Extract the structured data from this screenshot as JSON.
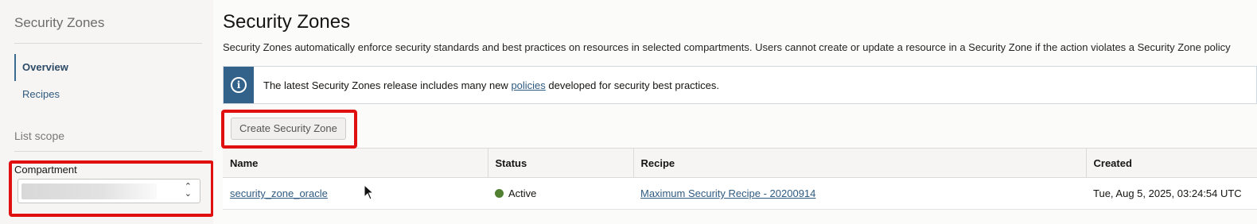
{
  "sidebar": {
    "title": "Security Zones",
    "nav": [
      {
        "label": "Overview",
        "active": true
      },
      {
        "label": "Recipes",
        "active": false
      }
    ],
    "scope_title": "List scope",
    "compartment_label": "Compartment",
    "compartment_value": ""
  },
  "main": {
    "title": "Security Zones",
    "description": "Security Zones automatically enforce security standards and best practices on resources in selected compartments. Users cannot create or update a resource in a Security Zone if the action violates a Security Zone policy",
    "banner": {
      "icon": "info-icon",
      "text_before": "The latest Security Zones release includes many new ",
      "link_text": "policies",
      "text_after": " developed for security best practices."
    },
    "create_button_label": "Create Security Zone",
    "table": {
      "columns": [
        "Name",
        "Status",
        "Recipe",
        "Created"
      ],
      "rows": [
        {
          "name": "security_zone_oracle",
          "status": "Active",
          "recipe": "Maximum Security Recipe - 20200914",
          "created": "Tue, Aug 5, 2025, 03:24:54 UTC"
        }
      ]
    }
  },
  "colors": {
    "highlight": "#e01010",
    "accent": "#32628a",
    "status_active": "#508030"
  }
}
